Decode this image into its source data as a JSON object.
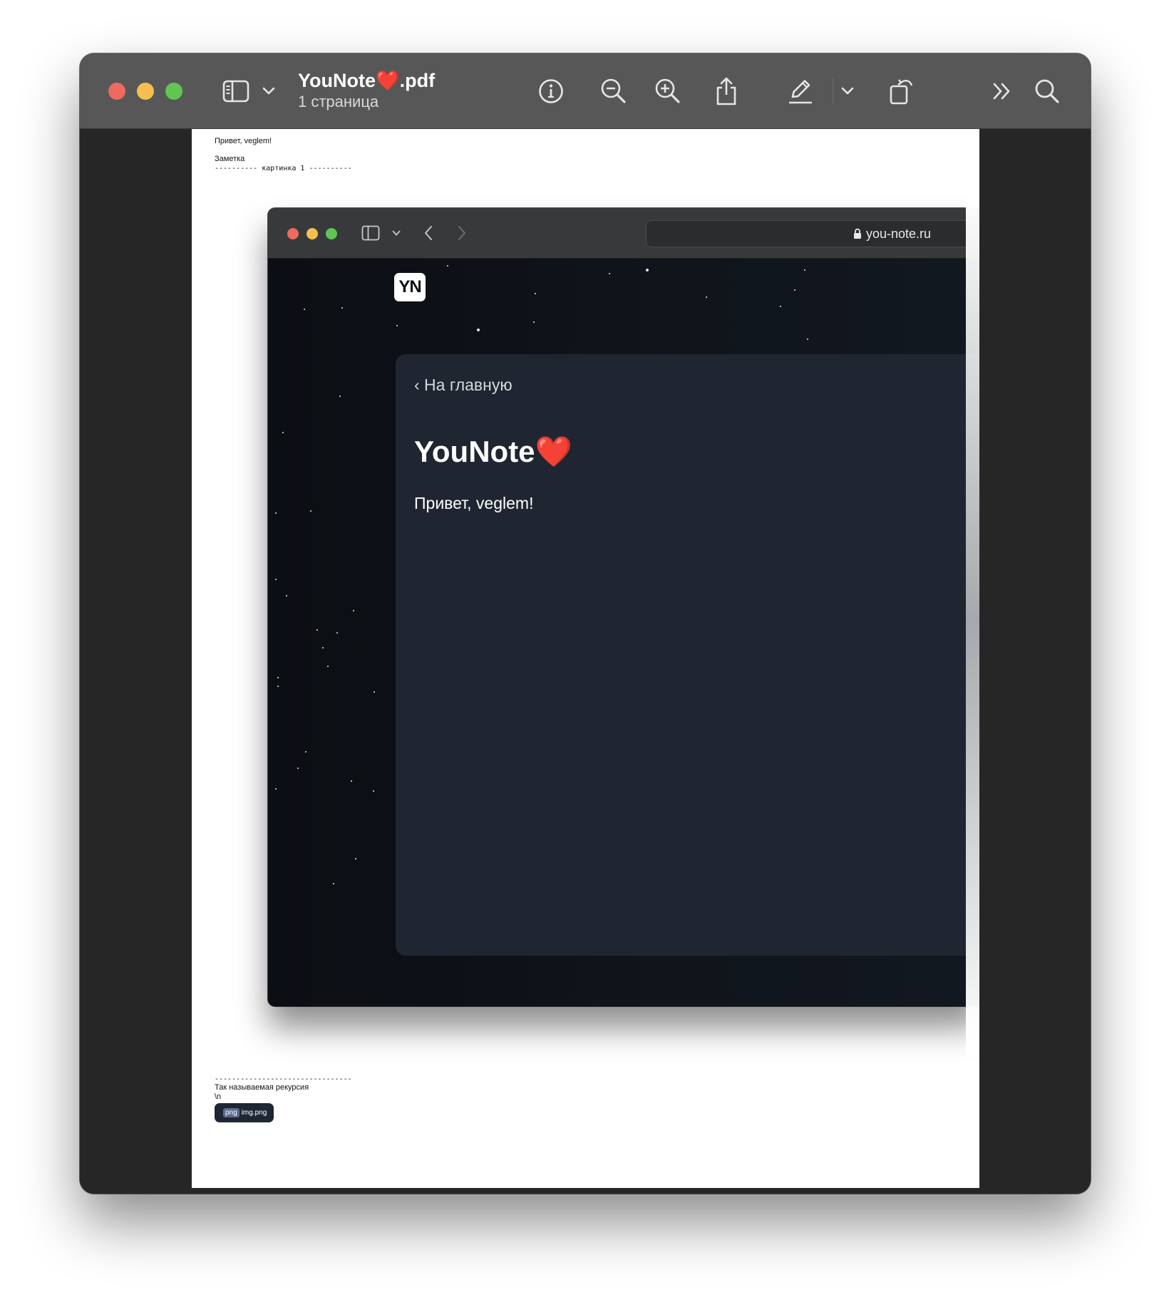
{
  "window": {
    "title": "YouNote❤️.pdf",
    "subtitle": "1 страница"
  },
  "toolbar": {
    "icons": [
      "sidebar-icon",
      "chevron-down-icon",
      "info-icon",
      "zoom-out-icon",
      "zoom-in-icon",
      "share-icon",
      "markup-pen-icon",
      "chevron-down-icon",
      "rotate-icon",
      "more-icon",
      "search-icon"
    ]
  },
  "pdf": {
    "greeting": "Привет, veglem!",
    "section_label": "Заметка",
    "image_header": "---------- картинка 1 ----------",
    "image_footer": "--------------------------------",
    "caption": "Так называемая рекурсия",
    "newline_text": "\\n",
    "attachment": {
      "type_tag": "png",
      "filename": "img.png"
    }
  },
  "embedded_browser": {
    "url": "you-note.ru",
    "logo_text": "YN",
    "back_link": "‹ На главную",
    "note_title": "YouNote❤️",
    "note_body": "Привет, veglem!"
  },
  "colors": {
    "titlebar": "#575757",
    "window_bg": "#262626",
    "card_bg": "#1f2631",
    "space_bg": "#0b0e13",
    "traffic_red": "#ed6a5e",
    "traffic_yellow": "#f4bf4f",
    "traffic_green": "#61c554"
  }
}
